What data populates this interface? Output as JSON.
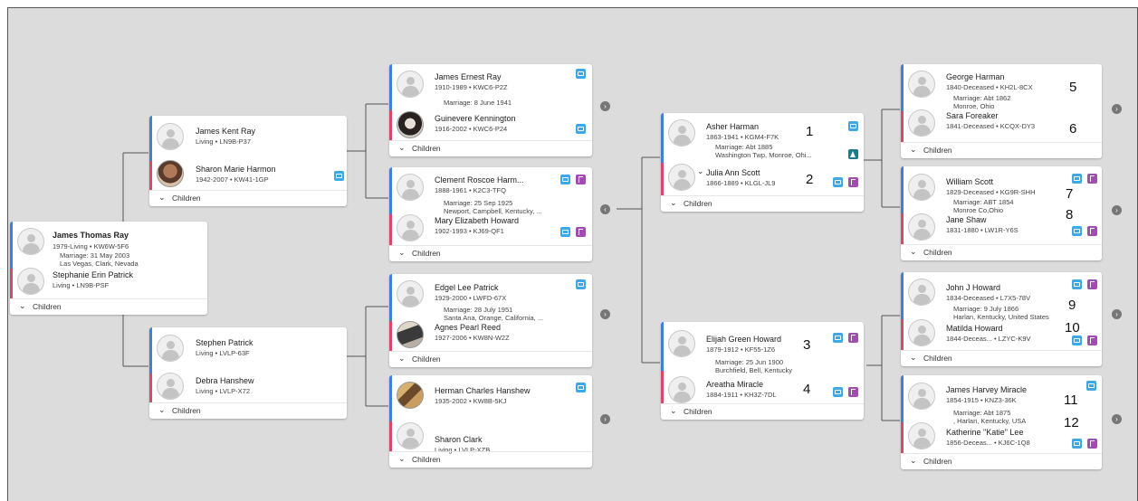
{
  "colors": {
    "father": "#3f7fd6",
    "mother": "#d9486b",
    "memories": "#3ca9e6",
    "sources": "#a24bb3",
    "hints": "#1a7e8a"
  },
  "icons": {
    "memories": "document-icon",
    "sources": "tree-icon",
    "hint": "hint-icon",
    "nav": "chevron-right-icon",
    "children": "chevron-down-icon"
  },
  "children_label": "Children",
  "couples": {
    "root": {
      "husband": {
        "name": "James Thomas Ray",
        "vitals": "1979-Living • KW6W-5F6"
      },
      "marriage": [
        "Marriage: 31 May 2003",
        "Las Vegas, Clark, Nevada"
      ],
      "wife": {
        "name": "Stephanie Erin Patrick",
        "vitals": "Living • LN9B-PSF"
      }
    },
    "g1a": {
      "husband": {
        "name": "James Kent Ray",
        "vitals": "Living • LN9B-P37"
      },
      "wife": {
        "name": "Sharon Marie Harmon",
        "vitals": "1942-2007 • KW41-1GP"
      }
    },
    "g1b": {
      "husband": {
        "name": "Stephen Patrick",
        "vitals": "Living • LVLP-63F"
      },
      "wife": {
        "name": "Debra Hanshew",
        "vitals": "Living • LVLP-X72"
      }
    },
    "g2a": {
      "husband": {
        "name": "James Ernest Ray",
        "vitals": "1910-1989 • KWC6-P2Z"
      },
      "marriage": [
        "Marriage: 8 June 1941"
      ],
      "wife": {
        "name": "Guinevere Kennington",
        "vitals": "1916-2002 • KWC6-P24"
      }
    },
    "g2b": {
      "husband": {
        "name": "Clement Roscoe Harm...",
        "vitals": "1888-1961 • K2C3-TFQ"
      },
      "marriage": [
        "Marriage: 25 Sep 1925",
        "Newport, Campbell, Kentucky, ..."
      ],
      "wife": {
        "name": "Mary Elizabeth Howard",
        "vitals": "1902-1993 • KJ69-QF1"
      }
    },
    "g2c": {
      "husband": {
        "name": "Edgel Lee Patrick",
        "vitals": "1929-2000 • LWFD-67X"
      },
      "marriage": [
        "Marriage: 28 July 1951",
        "Santa Ana, Orange, California, ..."
      ],
      "wife": {
        "name": "Agnes Pearl Reed",
        "vitals": "1927-2006 • KW8N-W2Z"
      }
    },
    "g2d": {
      "husband": {
        "name": "Herman Charles Hanshew",
        "vitals": "1935-2002 • KW8B-5KJ"
      },
      "wife": {
        "name": "Sharon Clark",
        "vitals": "Living • LVLP-XZB"
      }
    },
    "g3a": {
      "husband": {
        "name": "Asher Harman",
        "vitals": "1863-1941 • KGM4-F7K"
      },
      "marriage": [
        "Marriage: Abt 1885",
        "Washington Twp, Monroe, Ohi..."
      ],
      "wife": {
        "name": "Julia Ann Scott",
        "vitals": "1866-1889 • KLGL-JL9"
      }
    },
    "g3b": {
      "husband": {
        "name": "Elijah Green Howard",
        "vitals": "1879-1912 • KF55-1Z6"
      },
      "marriage": [
        "Marriage: 25 Jun 1900",
        "Burchfield, Bell, Kentucky"
      ],
      "wife": {
        "name": "Areatha Miracle",
        "vitals": "1884-1911 • KH3Z-7DL"
      }
    },
    "g4a": {
      "husband": {
        "name": "George Harman",
        "vitals": "1840-Deceased • KH2L-8CX"
      },
      "marriage": [
        "Marriage: Abt 1862",
        "Monroe, Ohio"
      ],
      "wife": {
        "name": "Sara Foreaker",
        "vitals": "1841-Deceased • KCQX-DY3"
      }
    },
    "g4b": {
      "husband": {
        "name": "William Scott",
        "vitals": "1829-Deceased • KG9R-SHH"
      },
      "marriage": [
        "Marriage: ABT 1854",
        "Monroe Co,Ohio"
      ],
      "wife": {
        "name": "Jane Shaw",
        "vitals": "1831-1880 • LW1R-Y6S"
      }
    },
    "g4c": {
      "husband": {
        "name": "John J Howard",
        "vitals": "1834-Deceased • L7X5-78V"
      },
      "marriage": [
        "Marriage: 9 July 1866",
        "Harlan, Kentucky, United States"
      ],
      "wife": {
        "name": "Matilda Howard",
        "vitals": "1844-Deceas... • LZYC-K9V"
      }
    },
    "g4d": {
      "husband": {
        "name": "James Harvey Miracle",
        "vitals": "1854-1915 • KNZ3-36K"
      },
      "marriage": [
        "Marriage: Abt 1875",
        ", Harlan, Kentucky, USA"
      ],
      "wife": {
        "name": "Katherine \"Katie\" Lee",
        "vitals": "1856-Deceas... • KJ6C-1Q8"
      }
    }
  },
  "annotations": [
    "1",
    "2",
    "3",
    "4",
    "5",
    "6",
    "7",
    "8",
    "9",
    "10",
    "11",
    "12"
  ]
}
